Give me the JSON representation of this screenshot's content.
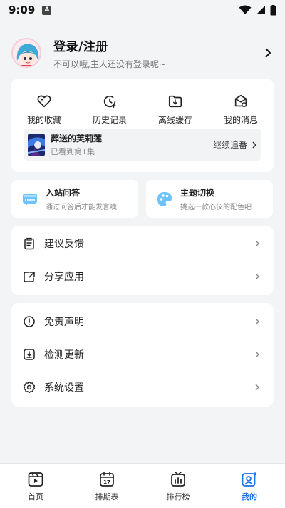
{
  "status_bar": {
    "time": "9:09",
    "notification_badge": "A"
  },
  "profile": {
    "title": "登录/注册",
    "subtitle": "不可以哦,主人还没有登录呢~"
  },
  "quick_actions": [
    {
      "label": "我的收藏",
      "icon": "heart-icon"
    },
    {
      "label": "历史记录",
      "icon": "history-clock-icon"
    },
    {
      "label": "离线缓存",
      "icon": "offline-download-icon"
    },
    {
      "label": "我的消息",
      "icon": "message-icon"
    }
  ],
  "continue_watching": {
    "title": "葬送的芙莉莲",
    "progress": "已看到第1集",
    "action": "继续追番"
  },
  "tiles": [
    {
      "title": "入站问答",
      "subtitle": "通过问答后才能发言噢",
      "icon": "quiz-icon"
    },
    {
      "title": "主题切换",
      "subtitle": "挑选一款心仪的配色吧",
      "icon": "palette-icon"
    }
  ],
  "menu_group_1": [
    {
      "label": "建议反馈",
      "icon": "feedback-icon"
    },
    {
      "label": "分享应用",
      "icon": "share-icon"
    }
  ],
  "menu_group_2": [
    {
      "label": "免责声明",
      "icon": "disclaimer-icon"
    },
    {
      "label": "检测更新",
      "icon": "update-icon"
    },
    {
      "label": "系统设置",
      "icon": "settings-gear-icon"
    }
  ],
  "bottom_nav": [
    {
      "label": "首页",
      "icon": "home-play-icon",
      "active": false
    },
    {
      "label": "排期表",
      "icon": "calendar-icon",
      "calendar_day": "17",
      "active": false
    },
    {
      "label": "排行榜",
      "icon": "ranking-icon",
      "active": false
    },
    {
      "label": "我的",
      "icon": "profile-icon",
      "active": true
    }
  ],
  "colors": {
    "accent": "#1a73e8",
    "background": "#f3f4f6"
  }
}
